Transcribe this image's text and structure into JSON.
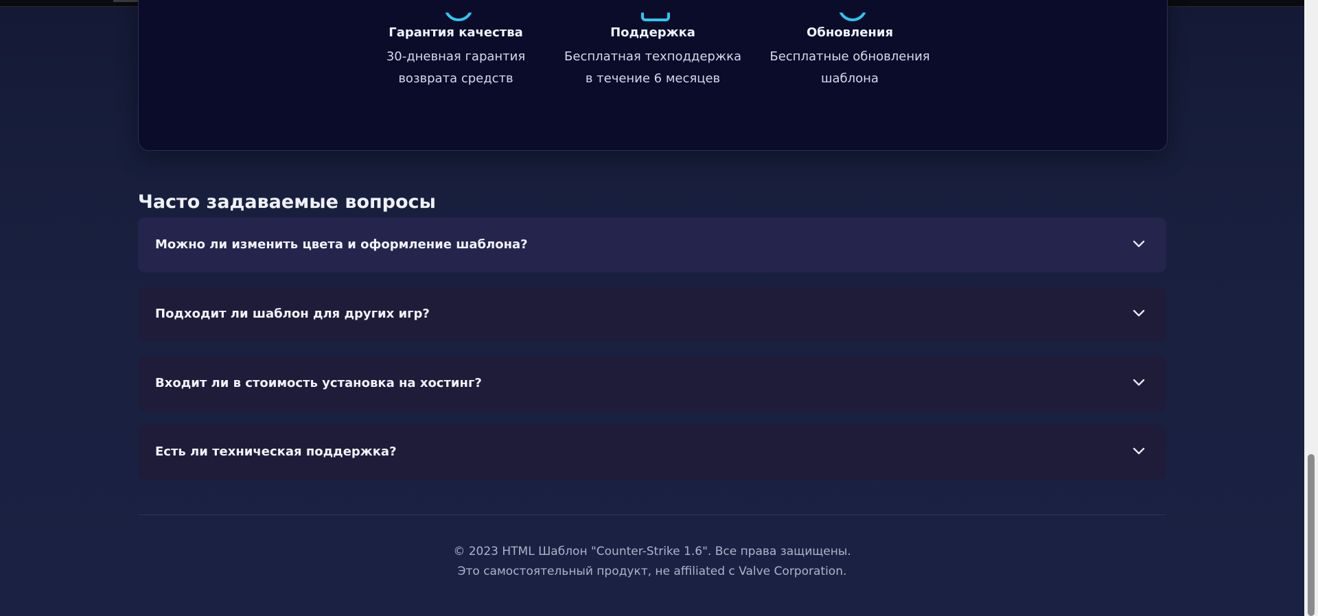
{
  "features": [
    {
      "icon": "shield-check-icon",
      "title": "Гарантия качества",
      "desc_line1": "30-дневная гарантия",
      "desc_line2": "возврата средств"
    },
    {
      "icon": "headset-icon",
      "title": "Поддержка",
      "desc_line1": "Бесплатная техподдержка",
      "desc_line2": "в течение 6 месяцев"
    },
    {
      "icon": "refresh-icon",
      "title": "Обновления",
      "desc_line1": "Бесплатные обновления",
      "desc_line2": "шаблона"
    }
  ],
  "faq": {
    "title": "Часто задаваемые вопросы",
    "items": [
      {
        "question": "Можно ли изменить цвета и оформление шаблона?"
      },
      {
        "question": "Подходит ли шаблон для других игр?"
      },
      {
        "question": "Входит ли в стоимость установка на хостинг?"
      },
      {
        "question": "Есть ли техническая поддержка?"
      }
    ]
  },
  "footer": {
    "line1": "© 2023 HTML Шаблон \"Counter-Strike 1.6\". Все права защищены.",
    "line2": "Это самостоятельный продукт, не affiliated с Valve Corporation."
  },
  "colors": {
    "accent": "#2ec7f0",
    "background": "#171d38",
    "card": "#0a0c2a",
    "faq_item": "#1f1c39",
    "faq_item_active": "#25244c"
  }
}
